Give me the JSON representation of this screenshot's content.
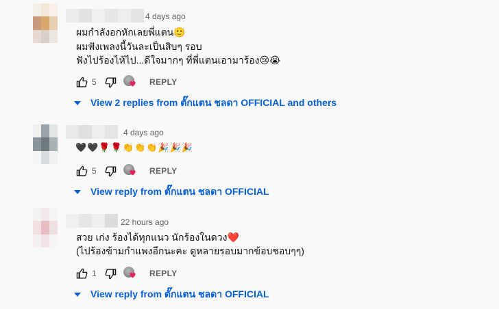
{
  "comments": [
    {
      "time": "4 days ago",
      "lines": [
        "ผมกำลังอกหักเลยพี่แตน🙂",
        "ผมฟังเพลงนี้วันละเป็นสิบๆ รอบ",
        "ฟังไปร้องไห้ไป...ดีใจมากๆ ที่พี่แตนเอามาร้อง😢😭"
      ],
      "likes": "5",
      "reply_label": "REPLY",
      "view_replies": "View 2 replies from ตั๊กแตน ชลดา OFFICIAL and others"
    },
    {
      "time": "4 days ago",
      "emojis": [
        "🖤",
        "🖤",
        "🌹",
        "🌹",
        "👏",
        "👏",
        "👏",
        "🎉",
        "🎉",
        "🎉"
      ],
      "likes": "5",
      "reply_label": "REPLY",
      "view_replies": "View reply from ตั๊กแตน ชลดา OFFICIAL"
    },
    {
      "time": "22 hours ago",
      "lines": [
        "สวย เก่ง ร้องได้ทุกแนว นักร้องในดวง❤️",
        "(ไปร้องข้ามกำแพงอีกนะคะ ดูหลายรอบมากข้อบชอบๆๆ)"
      ],
      "likes": "1",
      "reply_label": "REPLY",
      "view_replies": "View reply from ตั๊กแตน ชลดา OFFICIAL"
    }
  ],
  "colors": {
    "link": "#065fd4",
    "meta": "#606060",
    "heart": "#e0245e"
  },
  "icons": [
    "thumbs-up-icon",
    "thumbs-down-icon",
    "creator-heart-icon",
    "caret-down-icon"
  ]
}
